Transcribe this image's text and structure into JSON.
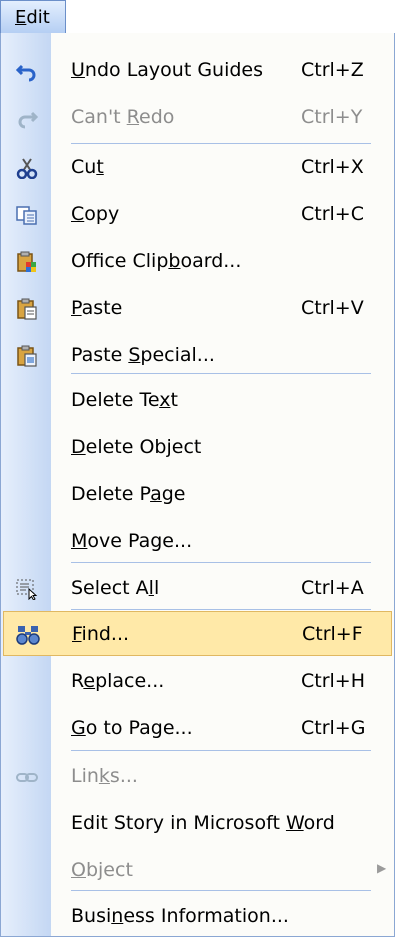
{
  "menu": {
    "title": "Edit",
    "colors": {
      "gutter": "#c4d7f3",
      "highlight": "#ffe9a8",
      "highlight_border": "#e0b862",
      "disabled_text": "#8d8d8d"
    },
    "items": [
      {
        "icon": "undo-icon",
        "pre": "",
        "key": "U",
        "post": "ndo Layout Guides",
        "shortcut": "Ctrl+Z"
      },
      {
        "icon": "redo-icon",
        "pre": "Can't ",
        "key": "R",
        "post": "edo",
        "shortcut": "Ctrl+Y"
      },
      {
        "icon": "cut-icon",
        "pre": "Cu",
        "key": "t",
        "post": "",
        "shortcut": "Ctrl+X"
      },
      {
        "icon": "copy-icon",
        "pre": "",
        "key": "C",
        "post": "opy",
        "shortcut": "Ctrl+C"
      },
      {
        "icon": "office-clipboard-icon",
        "pre": "Office Clip",
        "key": "b",
        "post": "oard...",
        "shortcut": ""
      },
      {
        "icon": "paste-icon",
        "pre": "",
        "key": "P",
        "post": "aste",
        "shortcut": "Ctrl+V"
      },
      {
        "icon": "paste-special-icon",
        "pre": "Paste ",
        "key": "S",
        "post": "pecial...",
        "shortcut": ""
      },
      {
        "icon": "",
        "pre": "Delete Te",
        "key": "x",
        "post": "t",
        "shortcut": ""
      },
      {
        "icon": "",
        "pre": "",
        "key": "D",
        "post": "elete Object",
        "shortcut": ""
      },
      {
        "icon": "",
        "pre": "Delete P",
        "key": "a",
        "post": "ge",
        "shortcut": ""
      },
      {
        "icon": "",
        "pre": "",
        "key": "M",
        "post": "ove Page...",
        "shortcut": ""
      },
      {
        "icon": "select-all-icon",
        "pre": "Select A",
        "key": "l",
        "post": "l",
        "shortcut": "Ctrl+A"
      },
      {
        "icon": "find-icon",
        "pre": "",
        "key": "F",
        "post": "ind...",
        "shortcut": "Ctrl+F"
      },
      {
        "icon": "",
        "pre": "R",
        "key": "e",
        "post": "place...",
        "shortcut": "Ctrl+H"
      },
      {
        "icon": "",
        "pre": "",
        "key": "G",
        "post": "o to Page...",
        "shortcut": "Ctrl+G"
      },
      {
        "icon": "links-icon",
        "pre": "Lin",
        "key": "k",
        "post": "s...",
        "shortcut": ""
      },
      {
        "icon": "",
        "pre": "Edit Story in Microsoft ",
        "key": "W",
        "post": "ord",
        "shortcut": ""
      },
      {
        "icon": "",
        "pre": "",
        "key": "O",
        "post": "bject",
        "shortcut": ""
      },
      {
        "icon": "",
        "pre": "Busi",
        "key": "n",
        "post": "ess Information...",
        "shortcut": ""
      }
    ]
  }
}
